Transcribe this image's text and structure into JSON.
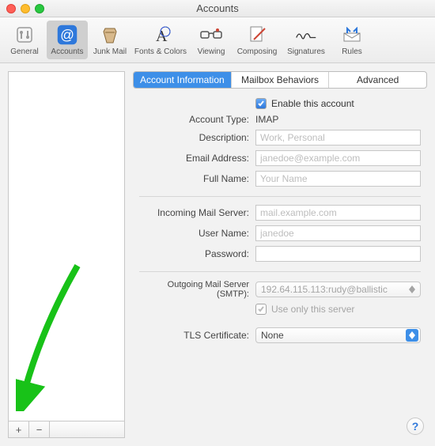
{
  "window": {
    "title": "Accounts"
  },
  "toolbar": {
    "items": [
      {
        "id": "general",
        "label": "General"
      },
      {
        "id": "accounts",
        "label": "Accounts"
      },
      {
        "id": "junk",
        "label": "Junk Mail"
      },
      {
        "id": "fonts",
        "label": "Fonts & Colors"
      },
      {
        "id": "viewing",
        "label": "Viewing"
      },
      {
        "id": "composing",
        "label": "Composing"
      },
      {
        "id": "signatures",
        "label": "Signatures"
      },
      {
        "id": "rules",
        "label": "Rules"
      }
    ]
  },
  "sidebar": {
    "add_label": "+",
    "remove_label": "−"
  },
  "tabs": {
    "items": [
      {
        "label": "Account Information"
      },
      {
        "label": "Mailbox Behaviors"
      },
      {
        "label": "Advanced"
      }
    ]
  },
  "form": {
    "enable_label": "Enable this account",
    "enable_checked": true,
    "account_type_label": "Account Type:",
    "account_type_value": "IMAP",
    "description_label": "Description:",
    "description_placeholder": "Work, Personal",
    "email_label": "Email Address:",
    "email_placeholder": "janedoe@example.com",
    "fullname_label": "Full Name:",
    "fullname_placeholder": "Your Name",
    "incoming_label": "Incoming Mail Server:",
    "incoming_placeholder": "mail.example.com",
    "username_label": "User Name:",
    "username_placeholder": "janedoe",
    "password_label": "Password:",
    "smtp_label": "Outgoing Mail Server (SMTP):",
    "smtp_value": "192.64.115.113:rudy@ballistic",
    "use_only_label": "Use only this server",
    "tls_label": "TLS Certificate:",
    "tls_value": "None"
  },
  "help": {
    "label": "?"
  }
}
